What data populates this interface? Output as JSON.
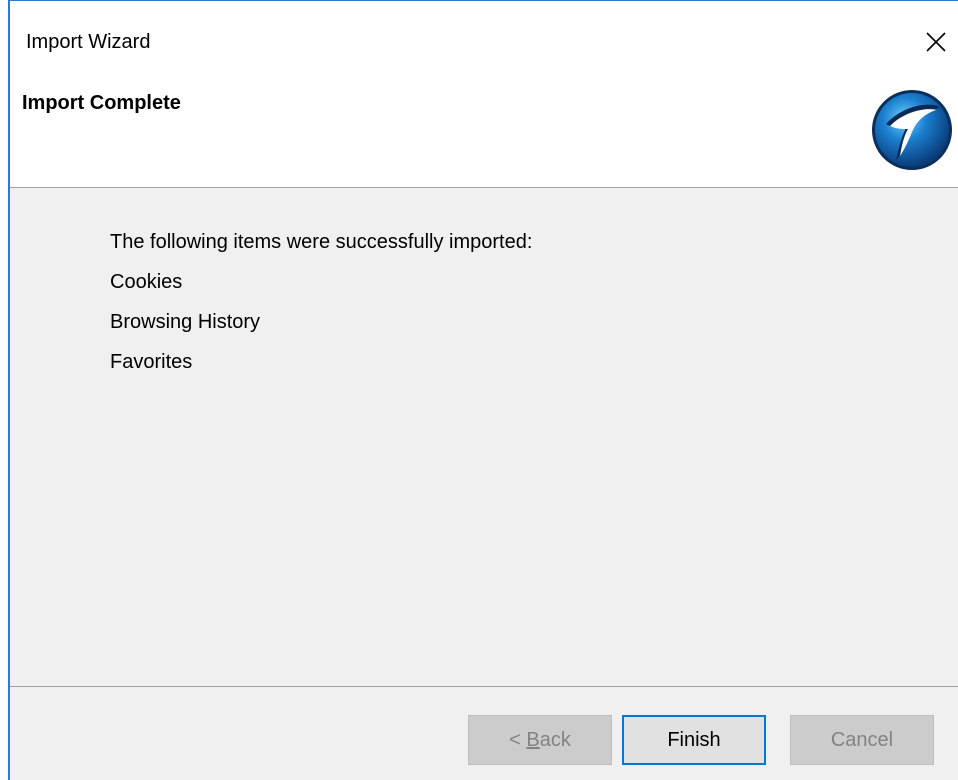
{
  "window": {
    "title": "Import Wizard",
    "close_icon": "close-icon"
  },
  "header": {
    "title": "Import Complete",
    "logo_icon": "app-logo-icon"
  },
  "content": {
    "intro": "The following items were successfully imported:",
    "items": [
      "Cookies",
      "Browsing History",
      "Favorites"
    ]
  },
  "buttons": {
    "back_prefix": "< ",
    "back_mnemonic": "B",
    "back_rest": "ack",
    "finish": "Finish",
    "cancel": "Cancel"
  },
  "colors": {
    "accent": "#0078d7",
    "window_border": "#2b79d8",
    "panel_bg": "#f0f0f0"
  }
}
